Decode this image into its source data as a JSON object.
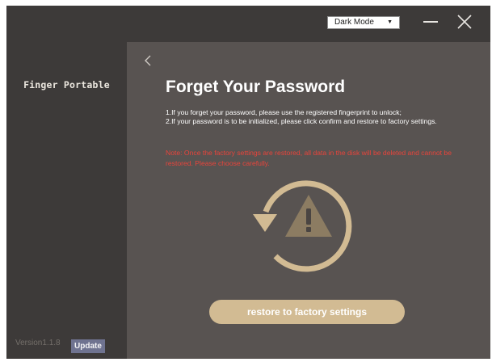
{
  "sidebar": {
    "brand": "Finger Portable",
    "version": "Version1.1.8",
    "update_label": "Update"
  },
  "titlebar": {
    "mode_select_value": "Dark Mode",
    "mode_icon": "dropdown-triangle-icon",
    "minimize_icon": "minimize-icon",
    "close_icon": "close-icon"
  },
  "main": {
    "back_icon": "chevron-left-icon",
    "title": "Forget Your Password",
    "lines": [
      "1.If you forget your password, please use the registered fingerprint to unlock;",
      "2.If your password is to be initialized, please click confirm and restore to factory settings."
    ],
    "note": "Note: Once the factory settings are restored, all data in the disk will be deleted and cannot be restored. Please choose carefully.",
    "graphic_icon": "restore-warning-icon",
    "restore_label": "restore to factory settings"
  },
  "colors": {
    "sidebar_bg": "#3d3a39",
    "main_bg": "#585351",
    "accent": "#d2bb93",
    "warning_text": "#e8443b",
    "update_bg": "#6f7390"
  }
}
